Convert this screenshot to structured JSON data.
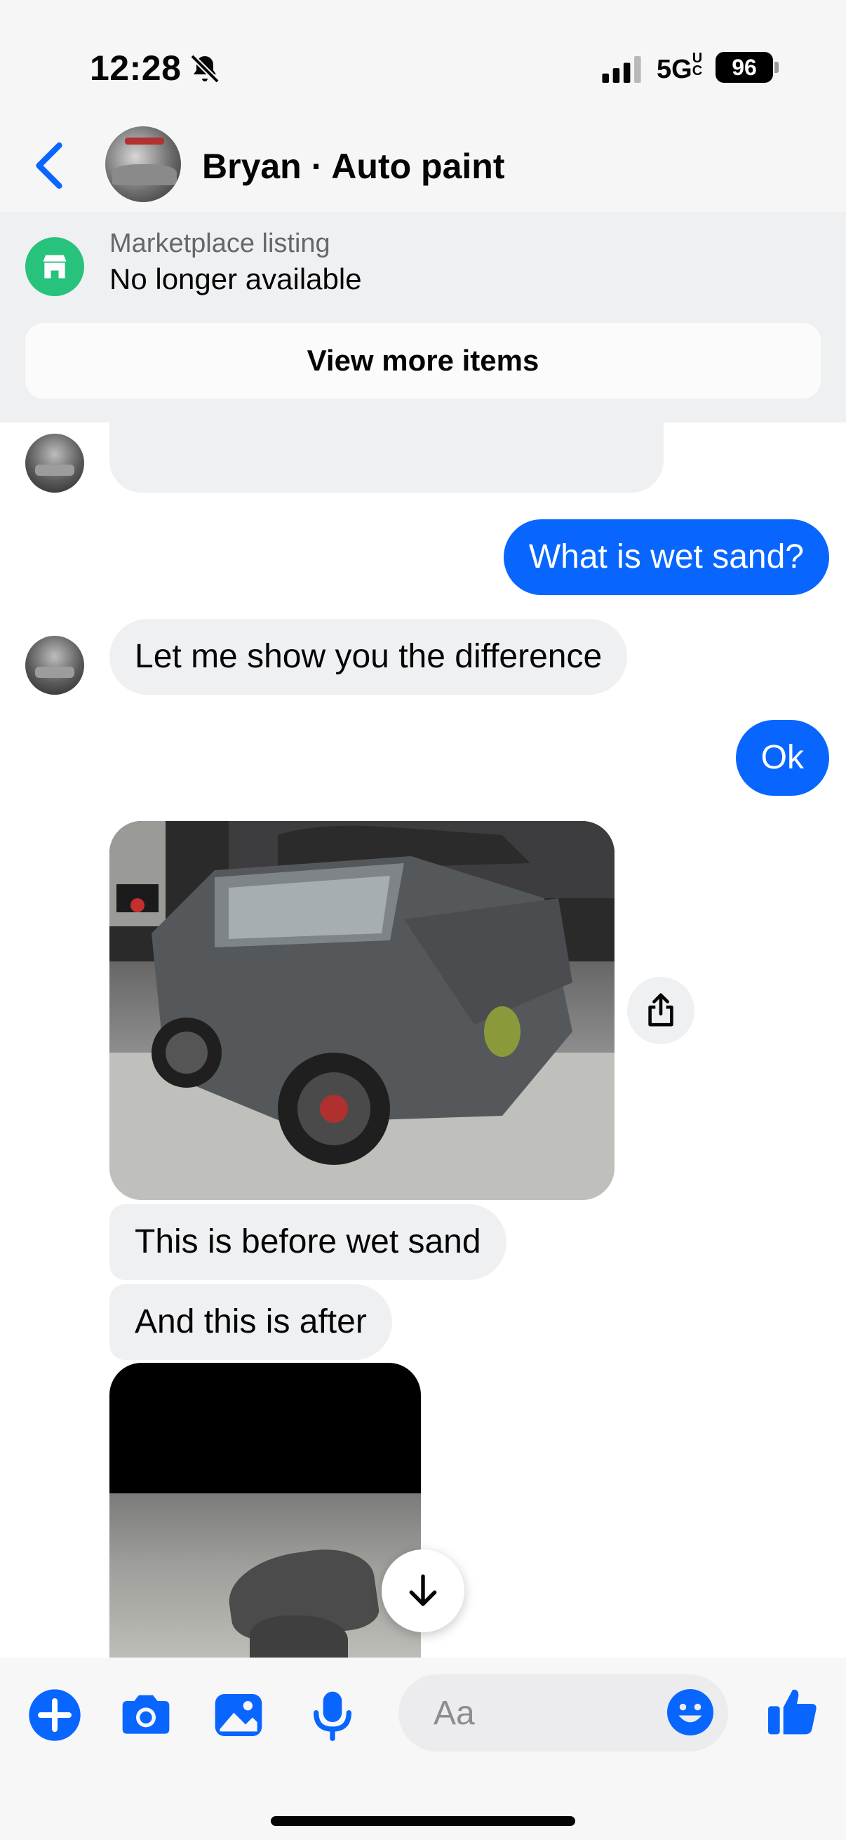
{
  "status_bar": {
    "time": "12:28",
    "network": "5G",
    "network_badge": "UC",
    "battery": "96",
    "icons": [
      "bell-slash-icon",
      "cellular-signal-icon",
      "battery-icon"
    ]
  },
  "header": {
    "contact_name": "Bryan · Auto paint",
    "icons": [
      "back-chevron-icon"
    ]
  },
  "marketplace": {
    "label": "Marketplace listing",
    "status": "No longer available",
    "button_label": "View more items",
    "icons": [
      "marketplace-store-icon"
    ]
  },
  "messages": [
    {
      "sender": "me",
      "text": "What is wet sand?"
    },
    {
      "sender": "them",
      "text": "Let me show you the difference"
    },
    {
      "sender": "me",
      "text": "Ok"
    },
    {
      "sender": "them",
      "type": "photo",
      "subject": "gray pickup truck in shop"
    },
    {
      "sender": "them",
      "text": "This is before wet sand"
    },
    {
      "sender": "them",
      "text": "And this is after"
    },
    {
      "sender": "them",
      "type": "photo",
      "subject": "fender on shop floor"
    }
  ],
  "composer": {
    "placeholder": "Aa",
    "icons": [
      "plus-icon",
      "camera-icon",
      "gallery-icon",
      "microphone-icon",
      "emoji-icon",
      "thumbs-up-icon"
    ]
  },
  "colors": {
    "accent": "#0866ff",
    "outgoing_bubble": "#0866ff",
    "incoming_bubble": "#eff0f2",
    "marketplace_green": "#27c27b",
    "banner_bg": "#eff0f2"
  }
}
